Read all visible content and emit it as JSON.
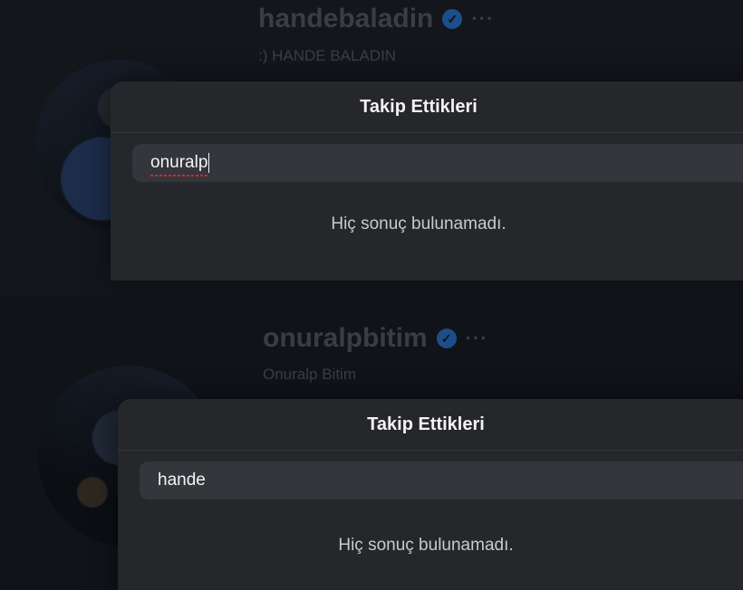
{
  "top": {
    "username": "handebaladin",
    "fullname": ":) HANDE BALADIN",
    "dialog": {
      "title": "Takip Ettikleri",
      "search_value": "onuralp",
      "empty_message": "Hiç sonuç bulunamadı."
    }
  },
  "bottom": {
    "username": "onuralpbitim",
    "fullname": "Onuralp Bitim",
    "dialog": {
      "title": "Takip Ettikleri",
      "search_value": "hande",
      "empty_message": "Hiç sonuç bulunamadı."
    }
  },
  "icons": {
    "verified": "verified-badge-icon",
    "more": "more-options-icon"
  },
  "colors": {
    "background": "#0f1115",
    "dialog": "#25272b",
    "search_field": "#34363b",
    "verified": "#1d4e8a"
  }
}
